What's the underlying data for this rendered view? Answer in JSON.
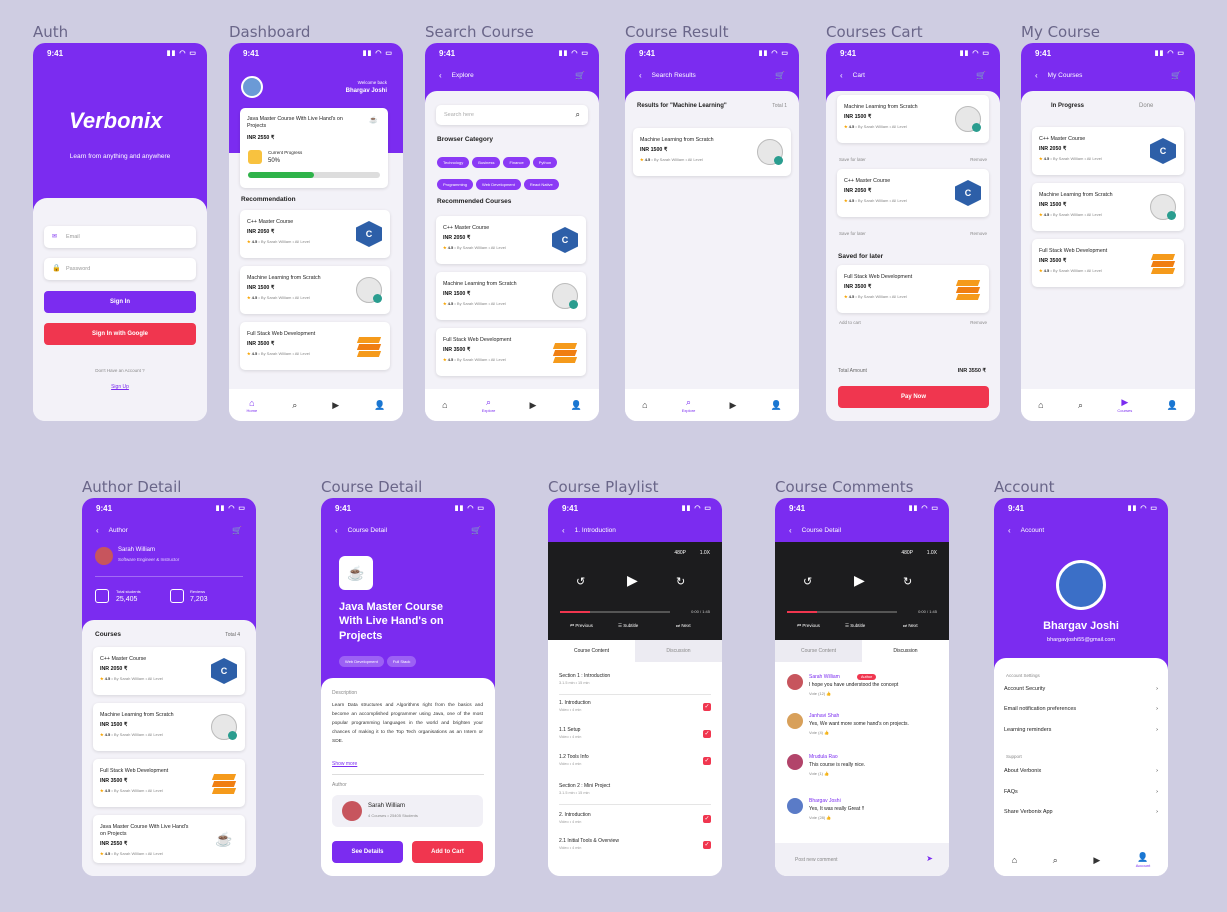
{
  "labels": {
    "auth": "Auth",
    "dashboard": "Dashboard",
    "search": "Search Course",
    "result": "Course Result",
    "cart": "Courses Cart",
    "mycourse": "My Course",
    "author": "Author Detail",
    "detail": "Course Detail",
    "playlist": "Course Playlist",
    "comments": "Course Comments",
    "account": "Account"
  },
  "time": "9:41",
  "auth": {
    "brand": "Verbonix",
    "tagline": "Learn from anything and anywhere",
    "email": "Email",
    "password": "Password",
    "signin": "Sign In",
    "google": "Sign In with Google",
    "noacc": "Don't Have an Account ?",
    "signup": "Sign Up"
  },
  "dash": {
    "welcome": "Welcome back",
    "name": "Bhargav Joshi",
    "course": "Java Master Course With Live Hand's on Projects",
    "price": "INR 2550 ₹",
    "progress_label": "Current Progress",
    "progress": "50%",
    "progress_value": 0.5,
    "rec": "Recommendation"
  },
  "courses": [
    {
      "title": "C++ Master Course",
      "price": "INR 2050 ₹",
      "rating": "4.5",
      "meta": "• By Sarah William • All Level"
    },
    {
      "title": "Machine Learning from Scratch",
      "price": "INR 1500 ₹",
      "rating": "4.5",
      "meta": "• By Sarah William • All Level"
    },
    {
      "title": "Full Stack Web Development",
      "price": "INR 3500 ₹",
      "rating": "4.5",
      "meta": "• By Sarah William • All Level"
    },
    {
      "title": "Java Master Course With Live Hand's on Projects",
      "price": "INR 2550 ₹",
      "rating": "4.5",
      "meta": "• By Sarah William • All Level"
    }
  ],
  "search": {
    "title": "Explore",
    "placeholder": "Search here",
    "browse": "Browser Category",
    "cats": [
      "Technology",
      "Business",
      "Finance",
      "Python",
      "Programming",
      "Web Development",
      "React Native"
    ],
    "recommended": "Recommended Courses"
  },
  "result": {
    "title": "Search Results",
    "heading": "Results for \"Machine Learning\"",
    "total": "Total 1"
  },
  "cartscr": {
    "title": "Cart",
    "save": "Save for later",
    "remove": "Remove",
    "saved": "Saved for later",
    "add": "Add to cart",
    "total_label": "Total Amount",
    "total": "INR 3550 ₹",
    "pay": "Pay Now"
  },
  "my": {
    "title": "My Courses",
    "inprog": "In Progress",
    "done": "Done"
  },
  "author": {
    "title": "Author",
    "name": "Sarah William",
    "role": "Software Engineer & Instructor",
    "students_label": "Total students",
    "students": "25,405",
    "reviews_label": "Reviews",
    "reviews": "7,203",
    "courses": "Courses",
    "total": "Total 4"
  },
  "detail": {
    "title": "Course Detail",
    "course": "Java Master Course With Live Hand's on Projects",
    "tags": [
      "Web Development",
      "Full Stack"
    ],
    "desc_label": "Description",
    "desc": "Learn Data structures and Algorithms right from the basics and become an accomplished programmer using Java, one of the most popular programming languages in the world and brighten your chances of making it to the Top Tech organisations as an Intern or SDE.",
    "more": "Show more",
    "author_label": "Author",
    "author": "Sarah William",
    "author_meta": "4 Courses • 25405 Students",
    "see": "See Details",
    "add": "Add to Cart"
  },
  "player": {
    "q": "480P",
    "speed": "1.0X",
    "time": "0:00 / 1:45",
    "prev": "Previous",
    "subs": "Subtitle",
    "next": "Next",
    "tab1": "Course Content",
    "tab2": "Discussion"
  },
  "playlist": {
    "title": "1. Introduction",
    "items": [
      {
        "t": "Section 1 : Introduction",
        "s": "3.1.5 min • 15 min",
        "c": false
      },
      {
        "t": "1. Introduction",
        "s": "Video • 4 min",
        "c": true
      },
      {
        "t": "1.1 Setup",
        "s": "Video • 4 min",
        "c": true
      },
      {
        "t": "1.2 Tools Info",
        "s": "Video • 4 min",
        "c": true
      },
      {
        "t": "Section 2 : Mini Project",
        "s": "3.1.5 min • 15 min",
        "c": false
      },
      {
        "t": "2. Introduction",
        "s": "Video • 4 min",
        "c": true
      },
      {
        "t": "2.1 Initial Tools & Overview",
        "s": "Video • 4 min",
        "c": true
      }
    ]
  },
  "comments": {
    "title": "Course Detail",
    "badge": "Author",
    "items": [
      {
        "n": "Sarah William",
        "t": "I hope you have understood the concept",
        "v": "Vote (12)"
      },
      {
        "n": "Janhavi Shah",
        "t": "Yes, We want more some hand's on projects.",
        "v": "Vote (4)"
      },
      {
        "n": "Mrudula Rao",
        "t": "This course is really nice.",
        "v": "Vote (1)"
      },
      {
        "n": "Bhargav Joshi",
        "t": "Yes, It was really Great !!",
        "v": "Vote (28)"
      }
    ],
    "post": "Post new comment"
  },
  "account": {
    "title": "Account",
    "name": "Bhargav Joshi",
    "email": "bhargavjoshi55@gmail.com",
    "settings": "Account Settings",
    "s1": "Account Security",
    "s2": "Email notification preferences",
    "s3": "Learning reminders",
    "support": "Support",
    "p1": "About Verbonix",
    "p2": "FAQs",
    "p3": "Share Verbonix App"
  },
  "tabs": {
    "home": "Home",
    "explore": "Explore",
    "courses": "Courses",
    "account": "Account"
  }
}
